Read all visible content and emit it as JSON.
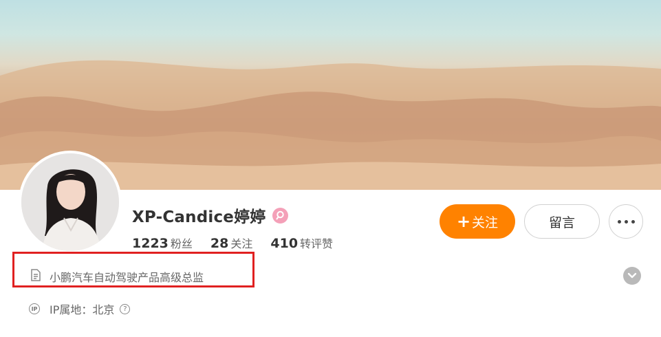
{
  "profile": {
    "name": "XP-Candice婷婷",
    "stats": [
      {
        "value": "1223",
        "label": "粉丝"
      },
      {
        "value": "28",
        "label": "关注"
      },
      {
        "value": "410",
        "label": "转评赞"
      }
    ],
    "bio": "小鹏汽车自动驾驶产品高级总监",
    "ip_location": "IP属地：北京"
  },
  "actions": {
    "follow_label": "关注",
    "follow_plus": "+",
    "message_label": "留言"
  },
  "icons": {
    "badge": "female-verified-icon",
    "bio": "document-icon",
    "ip": "ip-icon",
    "help": "question-icon",
    "more": "more-dots-icon",
    "expand": "chevron-down-icon"
  },
  "colors": {
    "accent": "#ff8200",
    "badge": "#f4a0b8",
    "highlight_border": "#e02020"
  }
}
